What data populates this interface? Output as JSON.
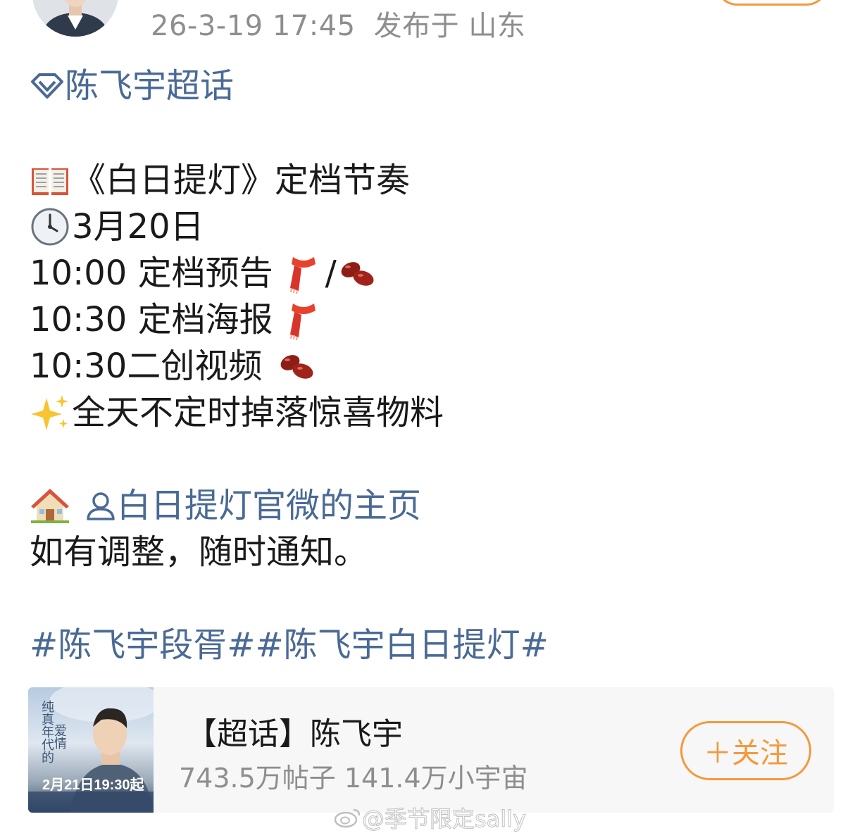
{
  "post": {
    "datetime": "26-3-19 17:45",
    "location": "发布于 山东",
    "supertopic_link": "陈飞宇超话",
    "lines": {
      "title": "《白日提灯》定档节奏",
      "date": "3月20日",
      "item1": "10:00 定档预告 ",
      "item1_sep": "/",
      "item2": "10:30 定档海报 ",
      "item3": "10:30二创视频 ",
      "item4": "全天不定时掉落惊喜物料",
      "homepage_link": "白日提灯官微的主页",
      "notice": "如有调整，随时通知。",
      "hashtags": "#陈飞宇段胥##陈飞宇白日提灯#"
    }
  },
  "card": {
    "title": "【超话】陈飞宇",
    "stats": "743.5万帖子 141.4万小宇宙",
    "follow_label": "＋关注",
    "thumb": {
      "vtext1": "纯真年代的",
      "vtext2": "爱情",
      "date": "2月21日19:30起"
    }
  },
  "watermark": "@季节限定sally",
  "colors": {
    "link": "#4a6a96",
    "meta": "#8e8e8e",
    "accent": "#f39a3d"
  },
  "icons": [
    "avatar",
    "diamond-icon",
    "book-emoji",
    "clock-emoji",
    "scarf-emoji",
    "beans-emoji",
    "sparkles-emoji",
    "house-emoji",
    "user-icon",
    "weibo-icon"
  ]
}
